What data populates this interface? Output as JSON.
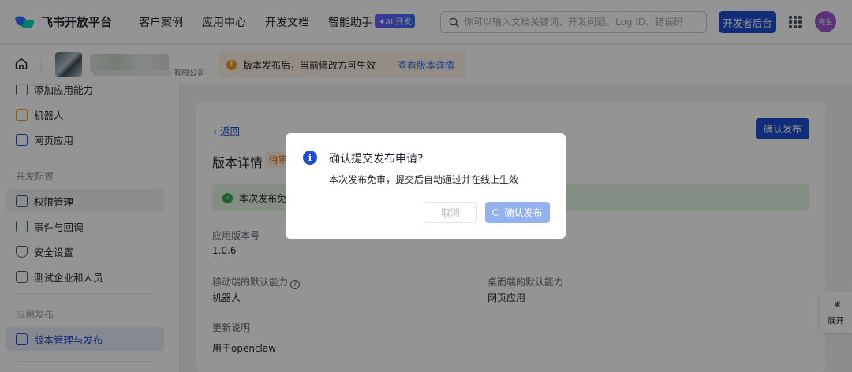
{
  "nav": {
    "logo_text": "飞书开放平台",
    "links": [
      "客户案例",
      "应用中心",
      "开发文档",
      "智能助手"
    ],
    "ai_badge": "✦AI 开发",
    "search_placeholder": "你可以输入文档关键词、开发问题、Log ID、错误码",
    "dev_console_label": "开发者后台",
    "avatar_text": "先生"
  },
  "subheader": {
    "company_suffix": "有限公司",
    "notice_text": "版本发布后，当前修改方可生效",
    "notice_link": "查看版本详情"
  },
  "sidebar": {
    "items_top": [
      "添加应用能力",
      "机器人",
      "网页应用"
    ],
    "section_dev": "开发配置",
    "items_dev": [
      "权限管理",
      "事件与回调",
      "安全设置",
      "测试企业和人员"
    ],
    "section_release": "应用发布",
    "items_release": [
      "版本管理与发布"
    ]
  },
  "main": {
    "back_label": "返回",
    "confirm_release_label": "确认发布",
    "version_title": "版本详情",
    "status_tag": "待审",
    "success_text": "本次发布免审",
    "app_version_label": "应用版本号",
    "app_version_value": "1.0.6",
    "mobile_default_label": "移动端的默认能力",
    "mobile_default_value": "机器人",
    "desktop_default_label": "桌面端的默认能力",
    "desktop_default_value": "网页应用",
    "update_notes_label": "更新说明",
    "update_notes_value": "用于openclaw"
  },
  "expand_panel": {
    "label": "展开"
  },
  "modal": {
    "title": "确认提交发布申请?",
    "body": "本次发布免审，提交后自动通过并在线上生效",
    "cancel_label": "取消",
    "confirm_label": "确认发布"
  },
  "colors": {
    "primary": "#1e4fd1",
    "link": "#3370ff",
    "warning": "#f59a23",
    "success": "#34a853",
    "overlay": "rgba(0,0,0,0.42)"
  }
}
